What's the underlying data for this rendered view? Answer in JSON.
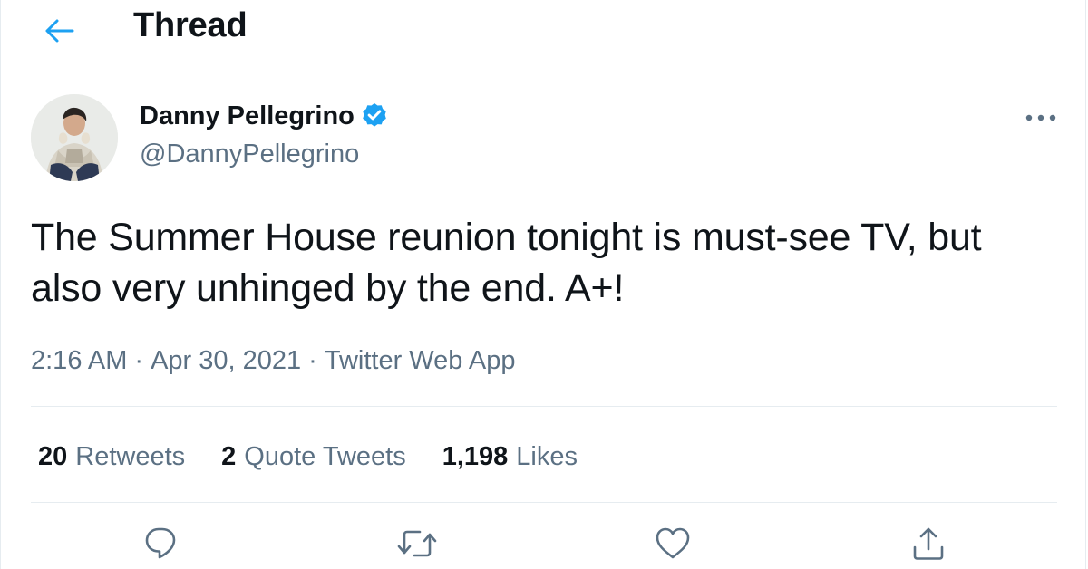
{
  "header": {
    "title": "Thread",
    "back_icon": "arrow-left-icon"
  },
  "tweet": {
    "author": {
      "display_name": "Danny Pellegrino",
      "handle": "@DannyPellegrino",
      "verified": true
    },
    "text": "The Summer House reunion tonight is must-see TV, but also very unhinged by the end. A+!",
    "time": "2:16 AM",
    "date": "Apr 30, 2021",
    "source": "Twitter Web App",
    "separator": "·",
    "stats": {
      "retweets": {
        "count": "20",
        "label": "Retweets"
      },
      "quote_tweets": {
        "count": "2",
        "label": "Quote Tweets"
      },
      "likes": {
        "count": "1,198",
        "label": "Likes"
      }
    }
  },
  "actions": [
    "reply-icon",
    "retweet-icon",
    "like-icon",
    "share-icon"
  ],
  "colors": {
    "accent": "#1da1f2",
    "text": "#0f1419",
    "secondary_text": "#5b7083",
    "divider": "#e6ecf0",
    "icon": "#5b7083"
  }
}
